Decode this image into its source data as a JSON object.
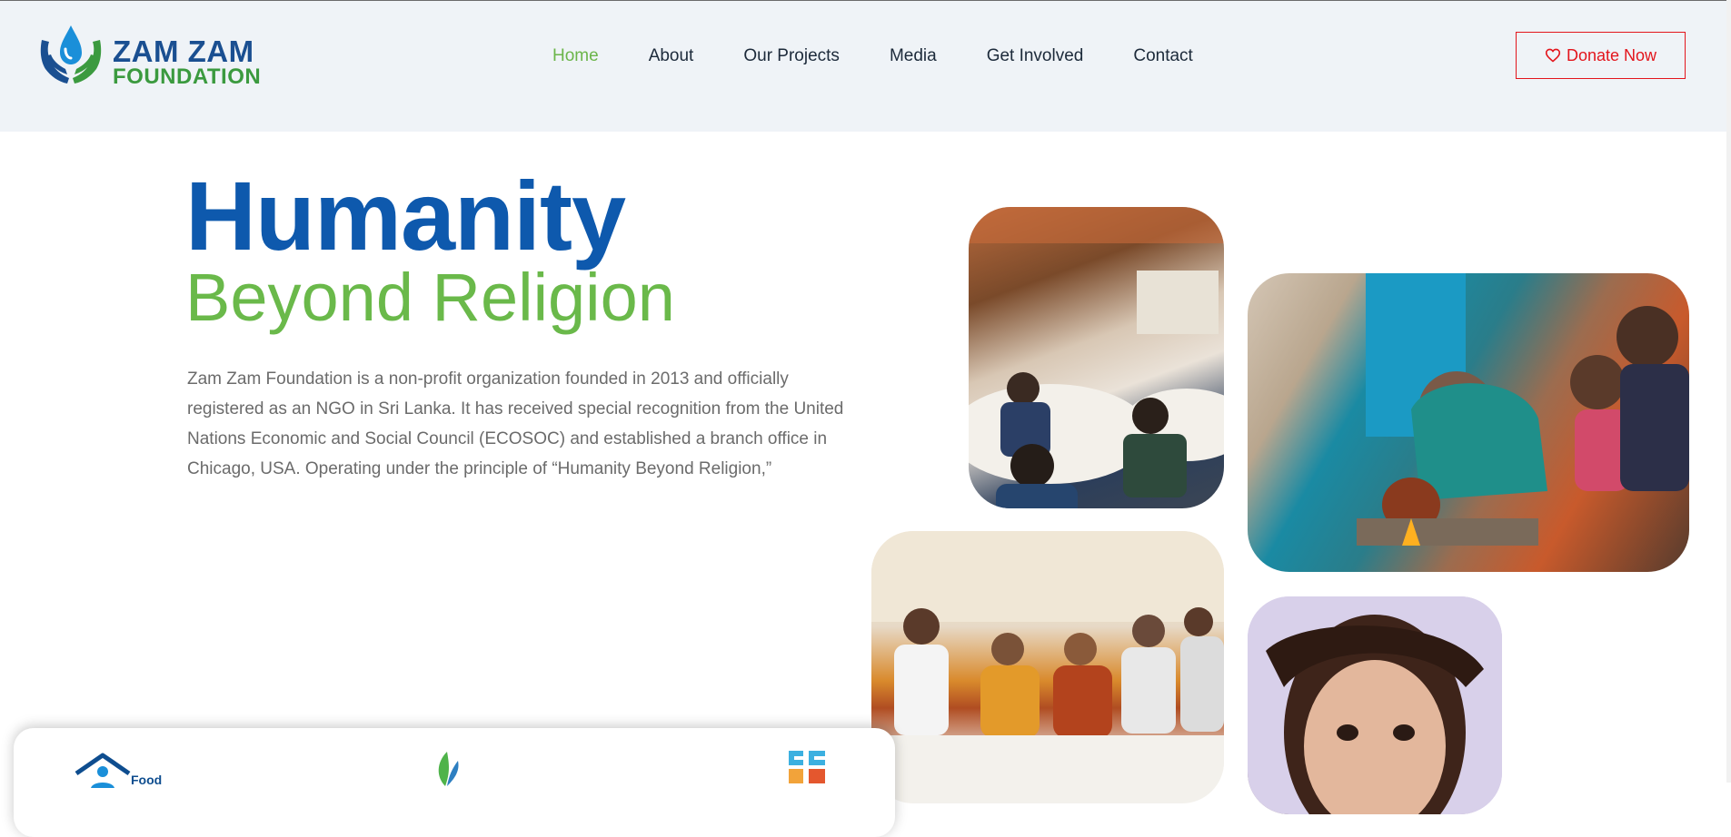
{
  "brand": {
    "line1": "ZAM ZAM",
    "line2": "FOUNDATION"
  },
  "nav": {
    "items": [
      {
        "label": "Home",
        "active": true
      },
      {
        "label": "About",
        "active": false
      },
      {
        "label": "Our Projects",
        "active": false
      },
      {
        "label": "Media",
        "active": false
      },
      {
        "label": "Get Involved",
        "active": false
      },
      {
        "label": "Contact",
        "active": false
      }
    ],
    "active_color": "#6bb54a"
  },
  "donate": {
    "label": "Donate Now",
    "icon": "heart-icon",
    "color": "#e3151c"
  },
  "hero": {
    "title": "Humanity",
    "subtitle": "Beyond Religion",
    "description": "Zam Zam Foundation is a non-profit organization founded in 2013 and officially registered as an NGO in Sri Lanka. It has received special recognition from the United Nations Economic and Social Council (ECOSOC) and established a branch office in Chicago, USA. Operating under the principle of “Humanity Beyond Religion,”",
    "title_color": "#0e59ad",
    "subtitle_color": "#6ab94a"
  },
  "gallery": [
    {
      "name": "conference-photo"
    },
    {
      "name": "cooking-family-photo"
    },
    {
      "name": "interfaith-panel-photo"
    },
    {
      "name": "child-portrait-photo"
    }
  ],
  "card": {
    "icons": [
      {
        "icon": "food-house-icon",
        "label": "Food"
      },
      {
        "icon": "leaf-icon"
      },
      {
        "icon": "education-icon"
      }
    ]
  }
}
